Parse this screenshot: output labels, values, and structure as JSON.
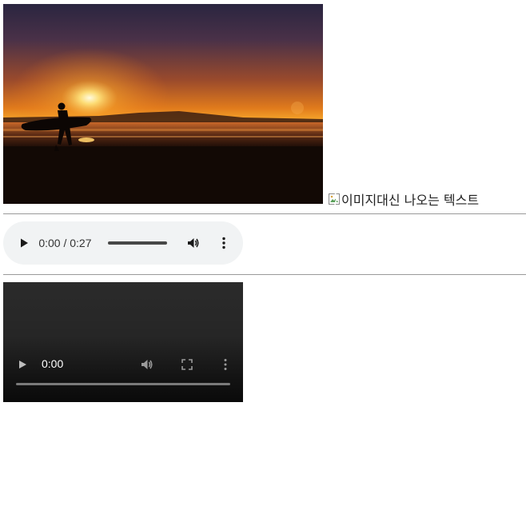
{
  "image": {
    "alt_text": "이미지대신 나오는 텍스트",
    "description_icon": "broken-image-icon"
  },
  "audio_player": {
    "current_time": "0:00",
    "duration": "0:27",
    "time_display": "0:00 / 0:27",
    "progress": 0,
    "icons": [
      "play-icon",
      "volume-icon",
      "more-options-icon"
    ],
    "background_color": "#f1f3f4"
  },
  "video_player": {
    "current_time": "0:00",
    "progress": 0,
    "icons": [
      "play-icon",
      "volume-icon",
      "fullscreen-icon",
      "more-options-icon"
    ],
    "background_color": "#1e1e1e"
  }
}
